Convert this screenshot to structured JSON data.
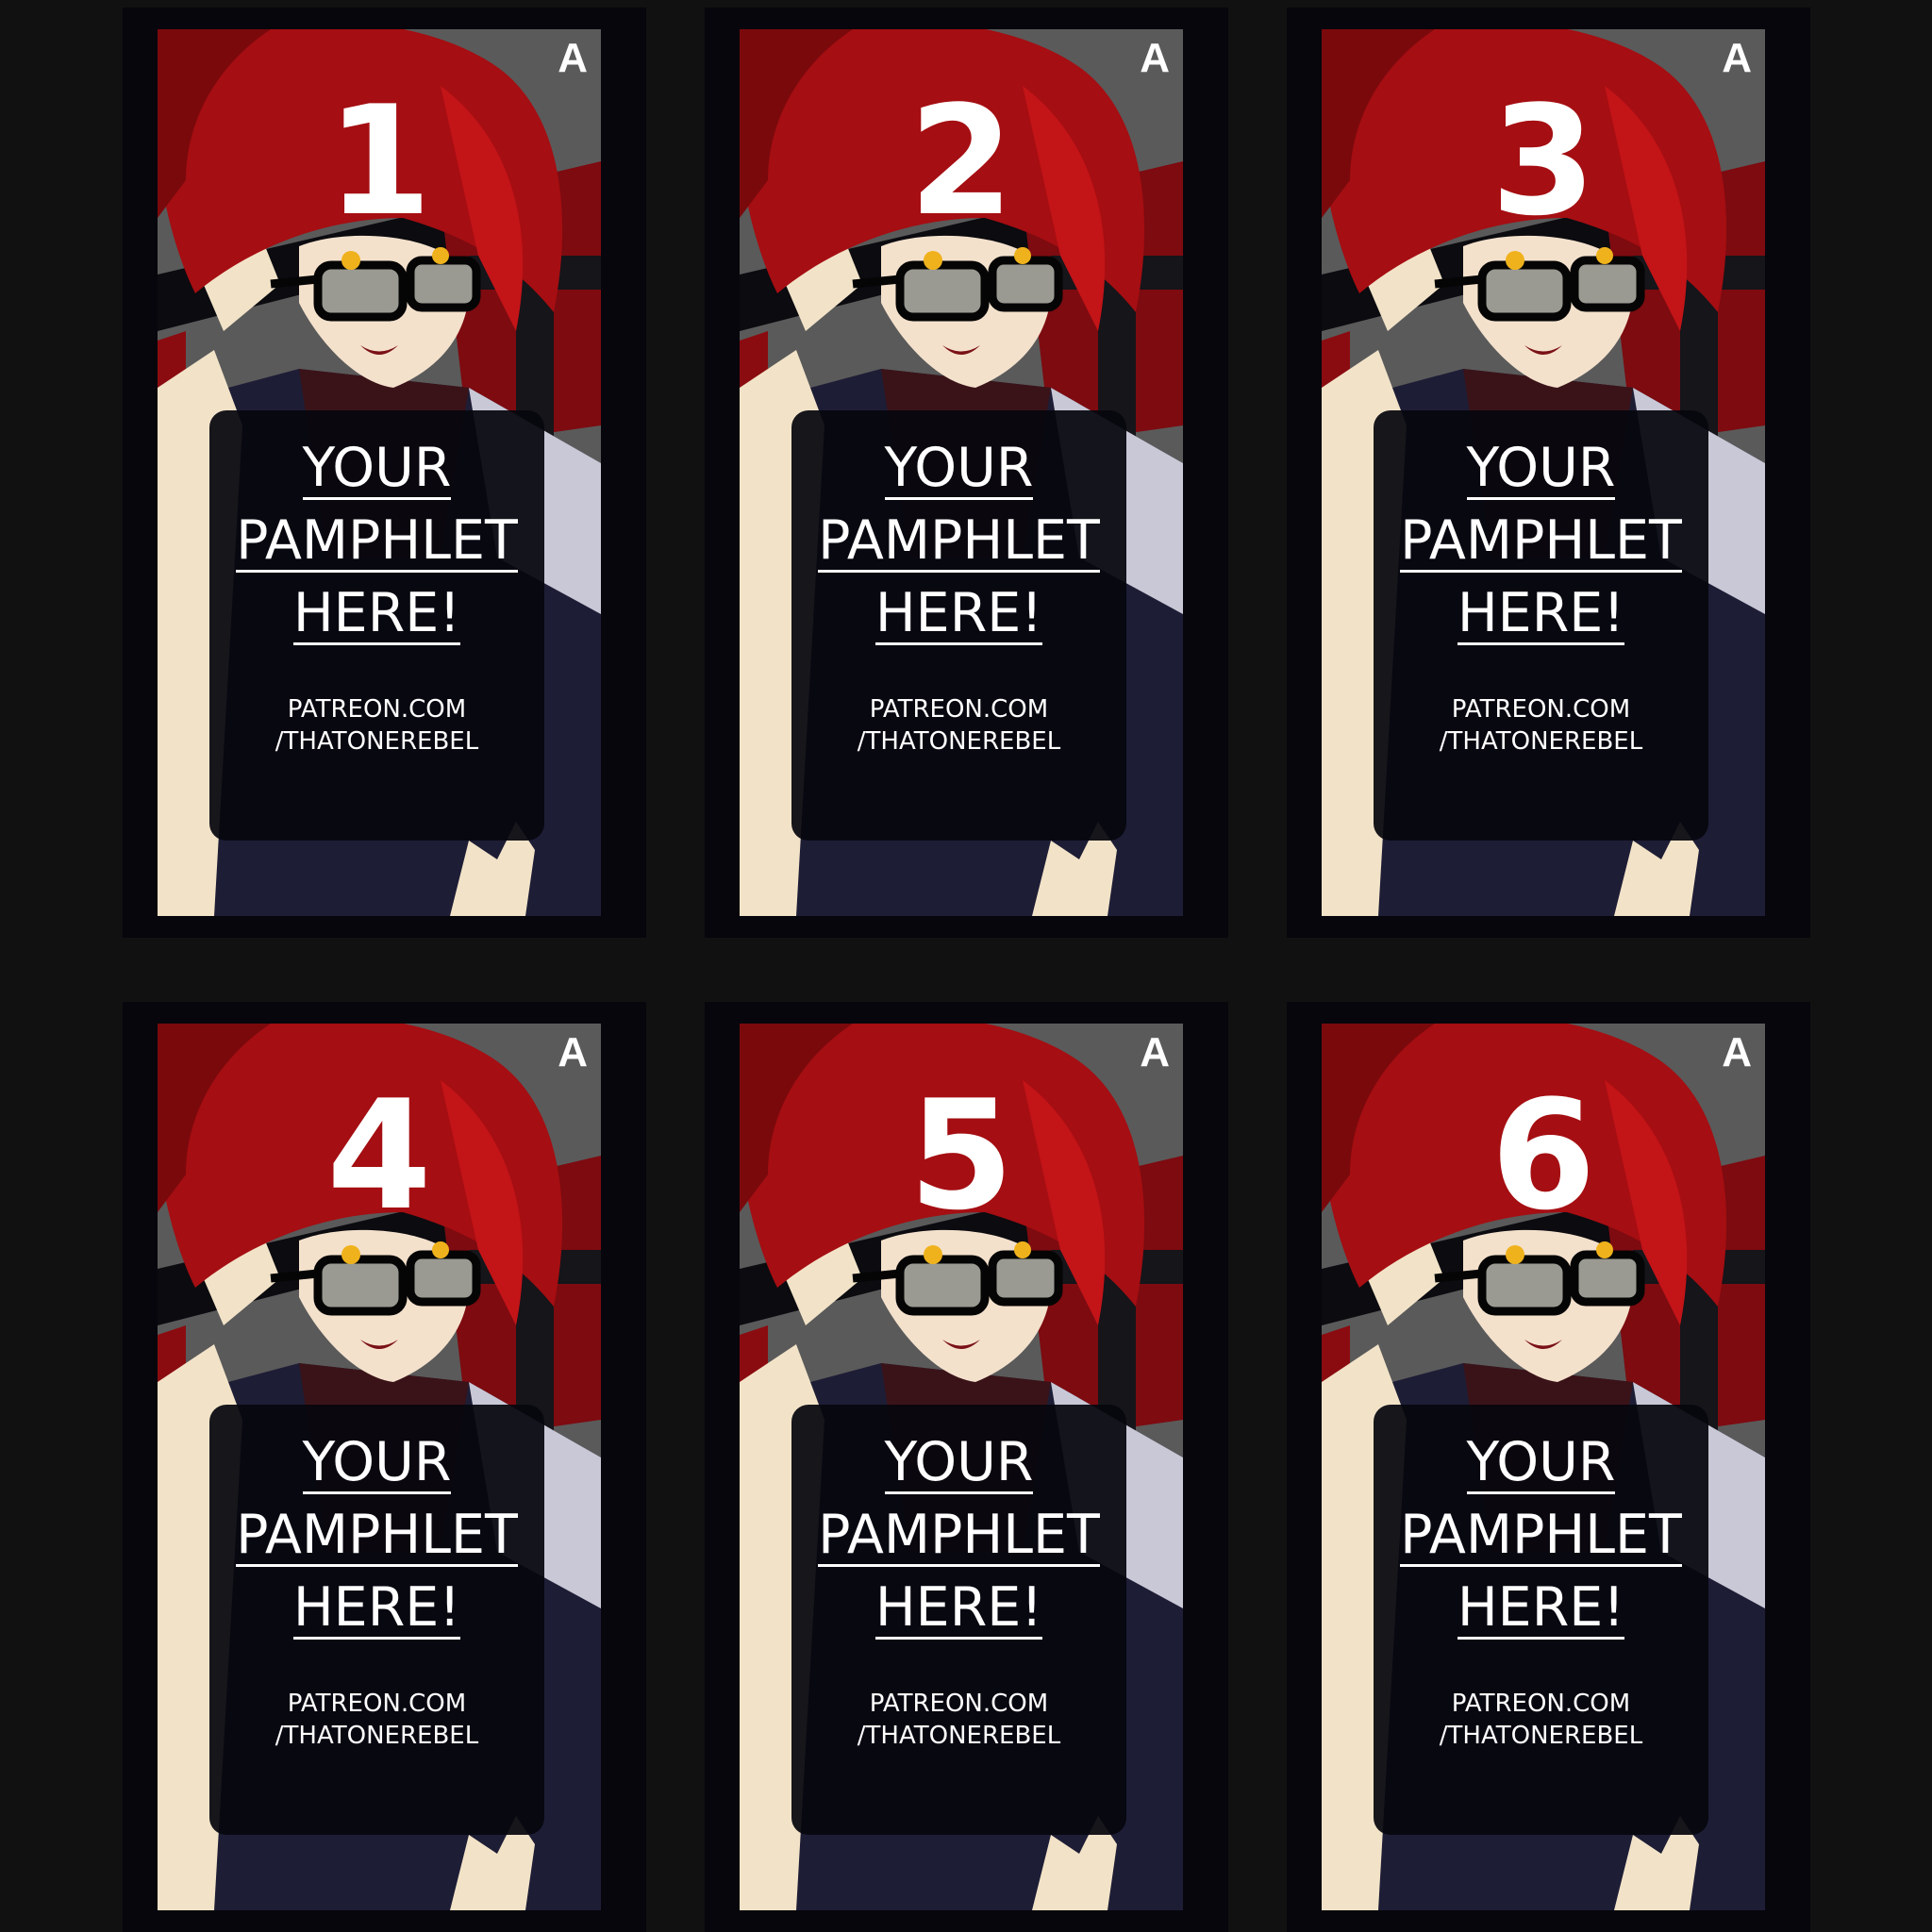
{
  "colors": {
    "page_background": "#111111",
    "card_border": "#06060c",
    "hair_red": "#a50e12",
    "gray_block": "#5a5a5a",
    "panel": "#06060e",
    "text": "#ffffff"
  },
  "cards": [
    {
      "corner": "A",
      "number": "1",
      "line1": "YOUR",
      "line2": "PAMPHLET",
      "line3": "HERE!",
      "url1": "PATREON.COM",
      "url2": "/THATONEREBEL"
    },
    {
      "corner": "A",
      "number": "2",
      "line1": "YOUR",
      "line2": "PAMPHLET",
      "line3": "HERE!",
      "url1": "PATREON.COM",
      "url2": "/THATONEREBEL"
    },
    {
      "corner": "A",
      "number": "3",
      "line1": "YOUR",
      "line2": "PAMPHLET",
      "line3": "HERE!",
      "url1": "PATREON.COM",
      "url2": "/THATONEREBEL"
    },
    {
      "corner": "A",
      "number": "4",
      "line1": "YOUR",
      "line2": "PAMPHLET",
      "line3": "HERE!",
      "url1": "PATREON.COM",
      "url2": "/THATONEREBEL"
    },
    {
      "corner": "A",
      "number": "5",
      "line1": "YOUR",
      "line2": "PAMPHLET",
      "line3": "HERE!",
      "url1": "PATREON.COM",
      "url2": "/THATONEREBEL"
    },
    {
      "corner": "A",
      "number": "6",
      "line1": "YOUR",
      "line2": "PAMPHLET",
      "line3": "HERE!",
      "url1": "PATREON.COM",
      "url2": "/THATONEREBEL"
    }
  ]
}
